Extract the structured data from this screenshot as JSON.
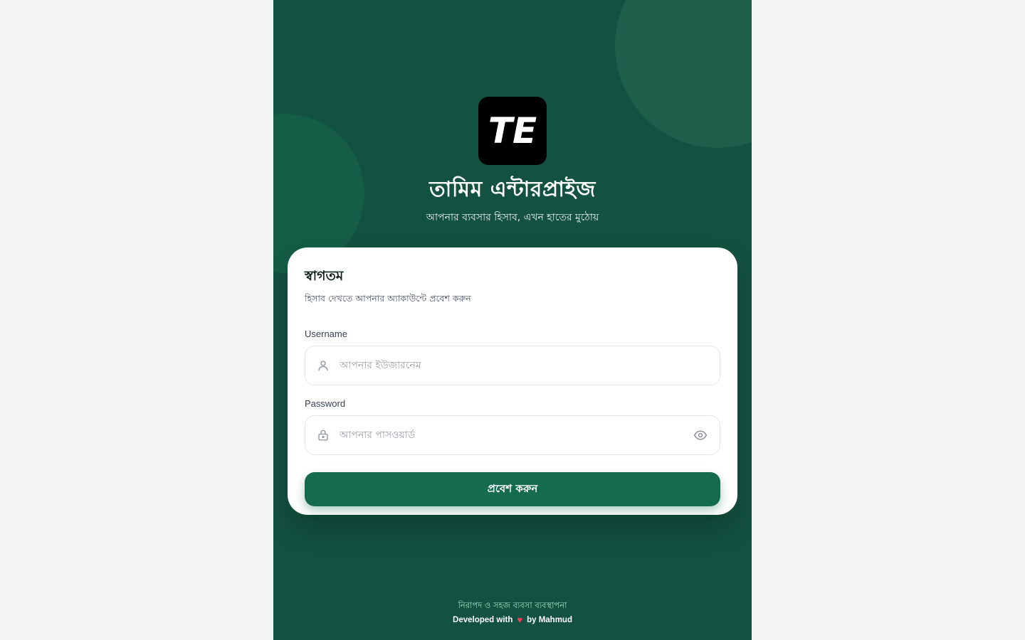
{
  "brand": {
    "title": "তামিম এন্টারপ্রাইজ",
    "tagline": "আপনার ব্যবসার হিসাব, এখন হাতের মুঠোয়",
    "logo_text": "TE"
  },
  "login": {
    "title": "স্বাগতম",
    "subtitle": "হিসাব দেখতে আপনার অ্যাকাউন্টে প্রবেশ করুন",
    "username_label": "Username",
    "username_placeholder": "আপনার ইউজারনেম",
    "password_label": "Password",
    "password_placeholder": "আপনার পাসওয়ার্ড",
    "submit_label": "প্রবেশ করুন"
  },
  "footer": {
    "line1": "নিরাপদ ও সহজ ব্যবসা ব্যবস্থাপনা",
    "developed_with": "Developed with",
    "heart": "♥",
    "by": "by Mahmud"
  },
  "colors": {
    "background": "#135240",
    "accent": "#146b4f",
    "page": "#f3f5f4"
  },
  "icons": {
    "username": "user-icon",
    "password": "lock-icon",
    "toggle": "eye-icon"
  }
}
